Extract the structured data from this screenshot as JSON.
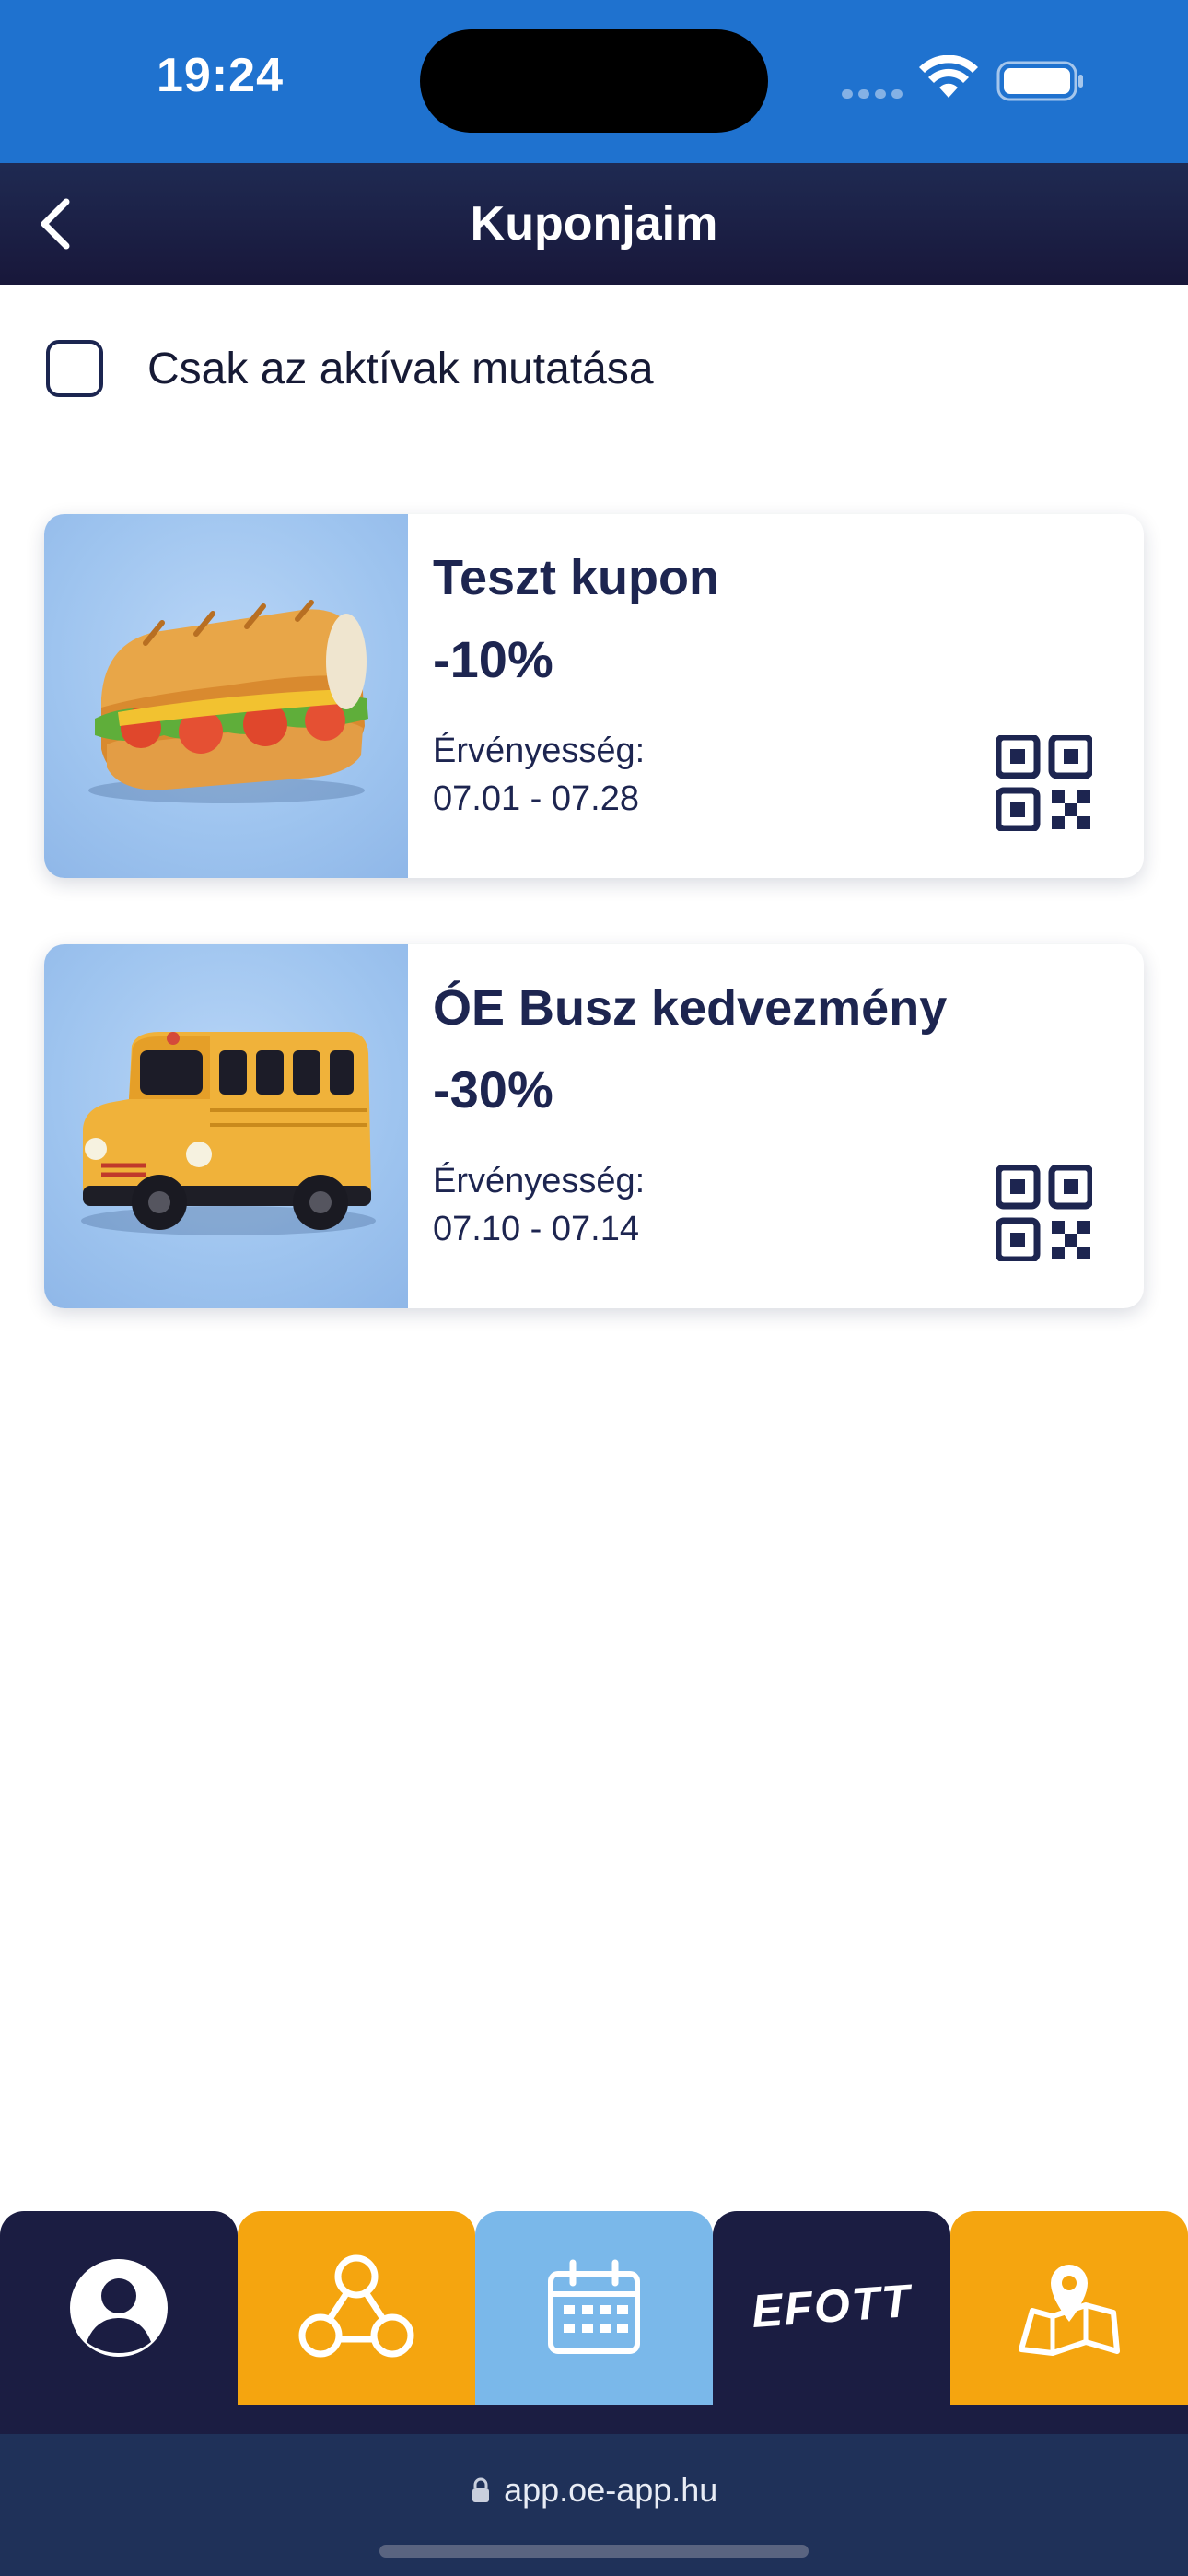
{
  "status_bar": {
    "time": "19:24"
  },
  "header": {
    "title": "Kuponjaim"
  },
  "filter": {
    "label": "Csak az aktívak mutatása",
    "checked": false
  },
  "coupons": [
    {
      "title": "Teszt kupon",
      "discount": "-10%",
      "validity_label": "Érvényesség:",
      "validity_dates": "07.01 - 07.28",
      "image": "sandwich"
    },
    {
      "title": "ÓE Busz kedvezmény",
      "discount": "-30%",
      "validity_label": "Érvényesség:",
      "validity_dates": "07.10 - 07.14",
      "image": "school-bus"
    }
  ],
  "tab_bar": {
    "tabs": [
      {
        "icon": "profile-icon",
        "color": "#1b1d42"
      },
      {
        "icon": "network-icon",
        "color": "#f5a50f"
      },
      {
        "icon": "calendar-icon",
        "color": "#7ab8ea"
      },
      {
        "icon": "efott-logo",
        "label": "EFOTT",
        "color": "#1b1d42"
      },
      {
        "icon": "map-pin-icon",
        "color": "#f5a50f"
      }
    ]
  },
  "browser": {
    "url": "app.oe-app.hu"
  },
  "colors": {
    "status_bar": "#1f72cf",
    "header": "#1b1d42",
    "accent_orange": "#f5a50f",
    "text_navy": "#1d2550"
  }
}
